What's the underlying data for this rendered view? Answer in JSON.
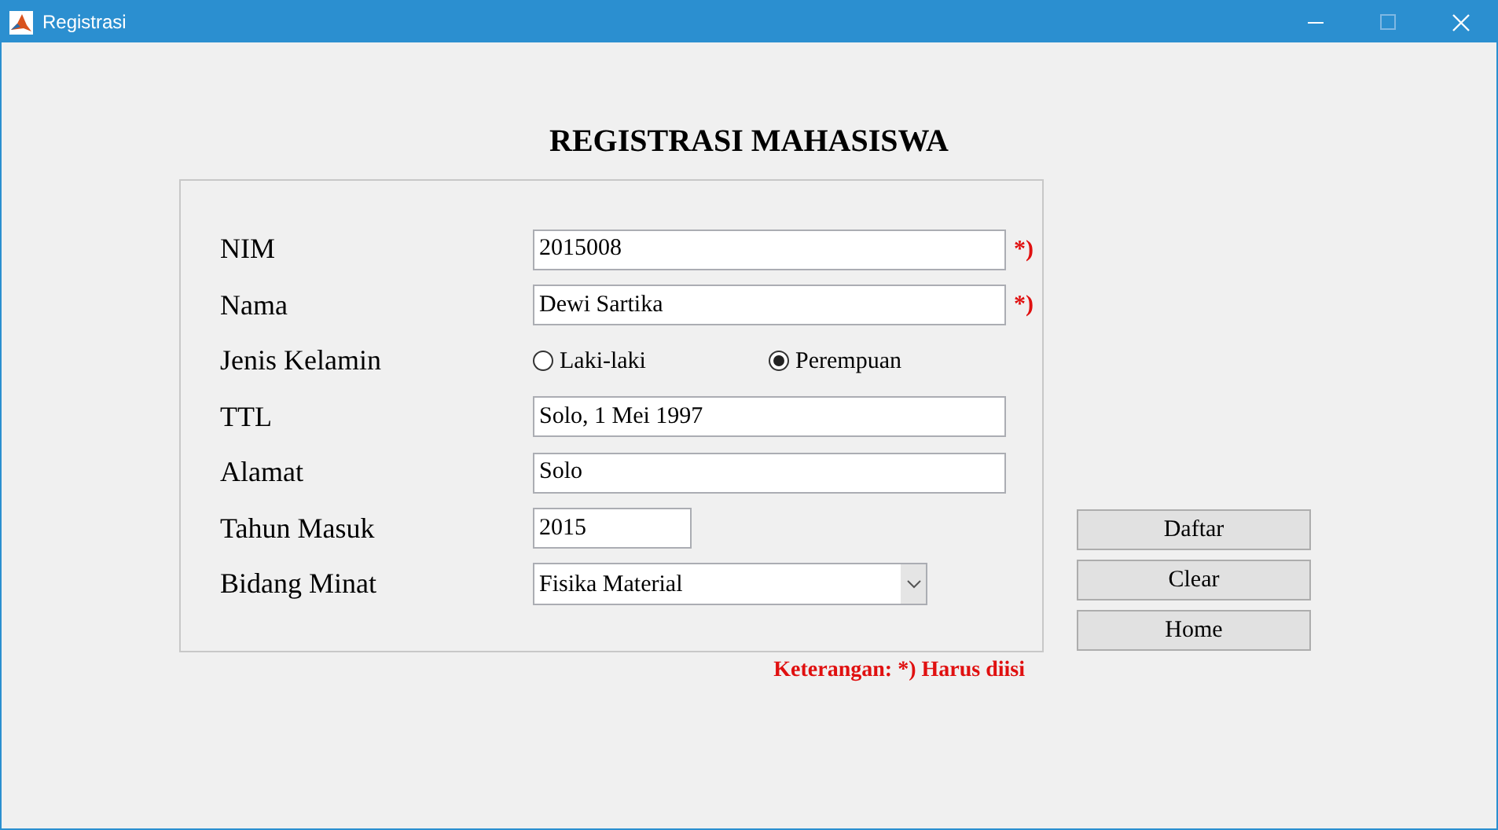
{
  "window": {
    "title": "Registrasi"
  },
  "heading": "REGISTRASI MAHASISWA",
  "fields": [
    {
      "kind": "text",
      "label": "NIM",
      "value": "2015008",
      "required_mark": "*)"
    },
    {
      "kind": "text",
      "label": "Nama",
      "value": "Dewi Sartika",
      "required_mark": "*)"
    },
    {
      "kind": "radio",
      "label": "Jenis Kelamin",
      "options": [
        {
          "label": "Laki-laki",
          "selected": false
        },
        {
          "label": "Perempuan",
          "selected": true
        }
      ]
    },
    {
      "kind": "text",
      "label": "TTL",
      "value": "Solo, 1 Mei 1997"
    },
    {
      "kind": "text",
      "label": "Alamat",
      "value": "Solo"
    },
    {
      "kind": "short",
      "label": "Tahun Masuk",
      "value": "2015"
    },
    {
      "kind": "select",
      "label": "Bidang Minat",
      "value": "Fisika Material"
    }
  ],
  "buttons": [
    "Daftar",
    "Clear",
    "Home"
  ],
  "note": "Keterangan: *) Harus diisi"
}
